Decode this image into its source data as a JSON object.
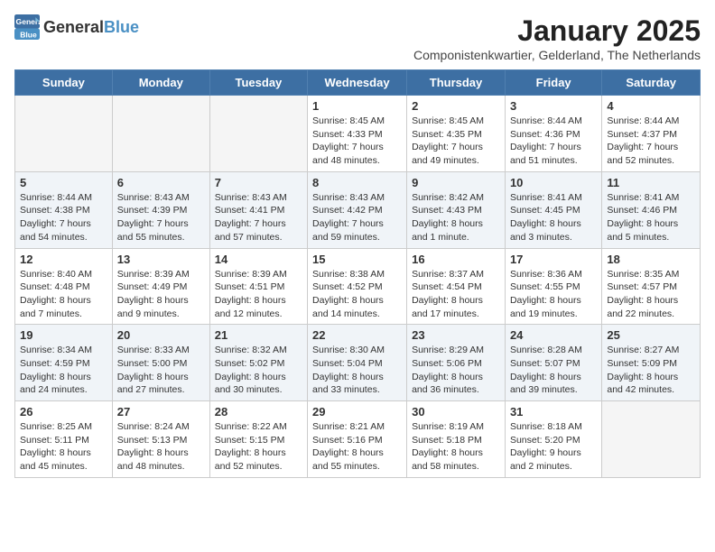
{
  "logo": {
    "general": "General",
    "blue": "Blue"
  },
  "title": "January 2025",
  "location": "Componistenkwartier, Gelderland, The Netherlands",
  "weekdays": [
    "Sunday",
    "Monday",
    "Tuesday",
    "Wednesday",
    "Thursday",
    "Friday",
    "Saturday"
  ],
  "weeks": [
    [
      {
        "day": "",
        "info": ""
      },
      {
        "day": "",
        "info": ""
      },
      {
        "day": "",
        "info": ""
      },
      {
        "day": "1",
        "info": "Sunrise: 8:45 AM\nSunset: 4:33 PM\nDaylight: 7 hours\nand 48 minutes."
      },
      {
        "day": "2",
        "info": "Sunrise: 8:45 AM\nSunset: 4:35 PM\nDaylight: 7 hours\nand 49 minutes."
      },
      {
        "day": "3",
        "info": "Sunrise: 8:44 AM\nSunset: 4:36 PM\nDaylight: 7 hours\nand 51 minutes."
      },
      {
        "day": "4",
        "info": "Sunrise: 8:44 AM\nSunset: 4:37 PM\nDaylight: 7 hours\nand 52 minutes."
      }
    ],
    [
      {
        "day": "5",
        "info": "Sunrise: 8:44 AM\nSunset: 4:38 PM\nDaylight: 7 hours\nand 54 minutes."
      },
      {
        "day": "6",
        "info": "Sunrise: 8:43 AM\nSunset: 4:39 PM\nDaylight: 7 hours\nand 55 minutes."
      },
      {
        "day": "7",
        "info": "Sunrise: 8:43 AM\nSunset: 4:41 PM\nDaylight: 7 hours\nand 57 minutes."
      },
      {
        "day": "8",
        "info": "Sunrise: 8:43 AM\nSunset: 4:42 PM\nDaylight: 7 hours\nand 59 minutes."
      },
      {
        "day": "9",
        "info": "Sunrise: 8:42 AM\nSunset: 4:43 PM\nDaylight: 8 hours\nand 1 minute."
      },
      {
        "day": "10",
        "info": "Sunrise: 8:41 AM\nSunset: 4:45 PM\nDaylight: 8 hours\nand 3 minutes."
      },
      {
        "day": "11",
        "info": "Sunrise: 8:41 AM\nSunset: 4:46 PM\nDaylight: 8 hours\nand 5 minutes."
      }
    ],
    [
      {
        "day": "12",
        "info": "Sunrise: 8:40 AM\nSunset: 4:48 PM\nDaylight: 8 hours\nand 7 minutes."
      },
      {
        "day": "13",
        "info": "Sunrise: 8:39 AM\nSunset: 4:49 PM\nDaylight: 8 hours\nand 9 minutes."
      },
      {
        "day": "14",
        "info": "Sunrise: 8:39 AM\nSunset: 4:51 PM\nDaylight: 8 hours\nand 12 minutes."
      },
      {
        "day": "15",
        "info": "Sunrise: 8:38 AM\nSunset: 4:52 PM\nDaylight: 8 hours\nand 14 minutes."
      },
      {
        "day": "16",
        "info": "Sunrise: 8:37 AM\nSunset: 4:54 PM\nDaylight: 8 hours\nand 17 minutes."
      },
      {
        "day": "17",
        "info": "Sunrise: 8:36 AM\nSunset: 4:55 PM\nDaylight: 8 hours\nand 19 minutes."
      },
      {
        "day": "18",
        "info": "Sunrise: 8:35 AM\nSunset: 4:57 PM\nDaylight: 8 hours\nand 22 minutes."
      }
    ],
    [
      {
        "day": "19",
        "info": "Sunrise: 8:34 AM\nSunset: 4:59 PM\nDaylight: 8 hours\nand 24 minutes."
      },
      {
        "day": "20",
        "info": "Sunrise: 8:33 AM\nSunset: 5:00 PM\nDaylight: 8 hours\nand 27 minutes."
      },
      {
        "day": "21",
        "info": "Sunrise: 8:32 AM\nSunset: 5:02 PM\nDaylight: 8 hours\nand 30 minutes."
      },
      {
        "day": "22",
        "info": "Sunrise: 8:30 AM\nSunset: 5:04 PM\nDaylight: 8 hours\nand 33 minutes."
      },
      {
        "day": "23",
        "info": "Sunrise: 8:29 AM\nSunset: 5:06 PM\nDaylight: 8 hours\nand 36 minutes."
      },
      {
        "day": "24",
        "info": "Sunrise: 8:28 AM\nSunset: 5:07 PM\nDaylight: 8 hours\nand 39 minutes."
      },
      {
        "day": "25",
        "info": "Sunrise: 8:27 AM\nSunset: 5:09 PM\nDaylight: 8 hours\nand 42 minutes."
      }
    ],
    [
      {
        "day": "26",
        "info": "Sunrise: 8:25 AM\nSunset: 5:11 PM\nDaylight: 8 hours\nand 45 minutes."
      },
      {
        "day": "27",
        "info": "Sunrise: 8:24 AM\nSunset: 5:13 PM\nDaylight: 8 hours\nand 48 minutes."
      },
      {
        "day": "28",
        "info": "Sunrise: 8:22 AM\nSunset: 5:15 PM\nDaylight: 8 hours\nand 52 minutes."
      },
      {
        "day": "29",
        "info": "Sunrise: 8:21 AM\nSunset: 5:16 PM\nDaylight: 8 hours\nand 55 minutes."
      },
      {
        "day": "30",
        "info": "Sunrise: 8:19 AM\nSunset: 5:18 PM\nDaylight: 8 hours\nand 58 minutes."
      },
      {
        "day": "31",
        "info": "Sunrise: 8:18 AM\nSunset: 5:20 PM\nDaylight: 9 hours\nand 2 minutes."
      },
      {
        "day": "",
        "info": ""
      }
    ]
  ]
}
